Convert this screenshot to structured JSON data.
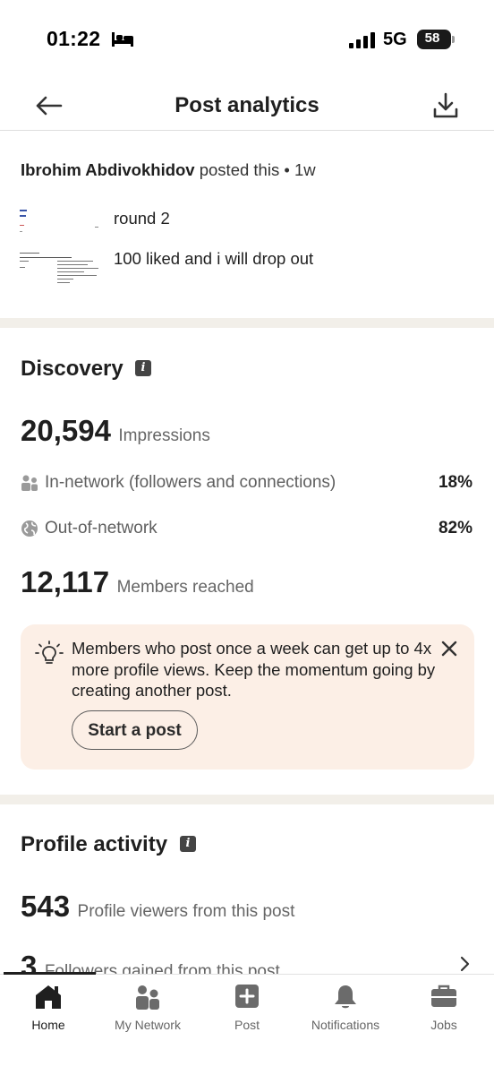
{
  "status_bar": {
    "time": "01:22",
    "network": "5G",
    "battery": "58"
  },
  "header": {
    "title": "Post analytics"
  },
  "post": {
    "author": "Ibrohim Abdivokhidov",
    "meta": " posted this • 1w",
    "line1": "round 2",
    "line2": "100 liked and i will drop out"
  },
  "discovery": {
    "title": "Discovery",
    "impressions_value": "20,594",
    "impressions_label": "Impressions",
    "in_network_label": "In-network (followers and connections)",
    "in_network_value": "18%",
    "out_network_label": "Out-of-network",
    "out_network_value": "82%",
    "members_value": "12,117",
    "members_label": "Members reached"
  },
  "tip": {
    "text": "Members who post once a week can get up to 4x more profile views. Keep the momentum going by creating another post.",
    "button": "Start a post"
  },
  "profile_activity": {
    "title": "Profile activity",
    "viewers_value": "543",
    "viewers_label": "Profile viewers from this post",
    "followers_value": "3",
    "followers_label": "Followers gained from this post"
  },
  "nav": {
    "home": "Home",
    "network": "My Network",
    "post": "Post",
    "notifications": "Notifications",
    "jobs": "Jobs"
  }
}
